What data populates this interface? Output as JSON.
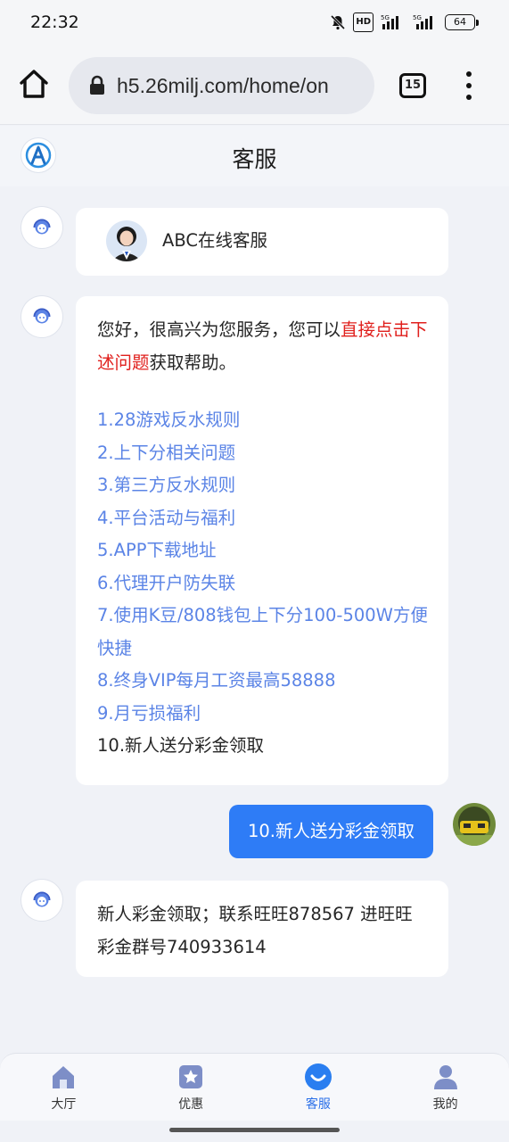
{
  "status_bar": {
    "time": "22:32",
    "hd_badge": "HD",
    "signal1": "5G",
    "signal2": "5G",
    "battery": "64"
  },
  "browser": {
    "url": "h5.26milj.com/home/on",
    "tab_count": "15"
  },
  "header": {
    "title": "客服"
  },
  "agent_card": {
    "name": "ABC在线客服"
  },
  "greeting": {
    "part1": "您好，很高兴为您服务，您可以",
    "highlight": "直接点击下述问题",
    "part2": "获取帮助。",
    "items": [
      "1.28游戏反水规则",
      "2.上下分相关问题",
      "3.第三方反水规则",
      "4.平台活动与福利",
      "5.APP下载地址",
      "6.代理开户防失联",
      "7.使用K豆/808钱包上下分100-500W方便快捷",
      "8.终身VIP每月工资最高58888",
      "9.月亏损福利",
      "10.新人送分彩金领取"
    ]
  },
  "user_message": "10.新人送分彩金领取",
  "reply": {
    "text": "新人彩金领取；联系旺旺878567 进旺旺彩金群号740933614"
  },
  "nav": [
    {
      "label": "大厅",
      "icon": "home-icon"
    },
    {
      "label": "优惠",
      "icon": "promo-star-icon"
    },
    {
      "label": "客服",
      "icon": "support-icon",
      "active": true
    },
    {
      "label": "我的",
      "icon": "profile-icon"
    }
  ],
  "colors": {
    "accent": "#2e7cf6",
    "link": "#5b84e6",
    "highlight": "#e0201d",
    "background": "#f0f2f7"
  }
}
